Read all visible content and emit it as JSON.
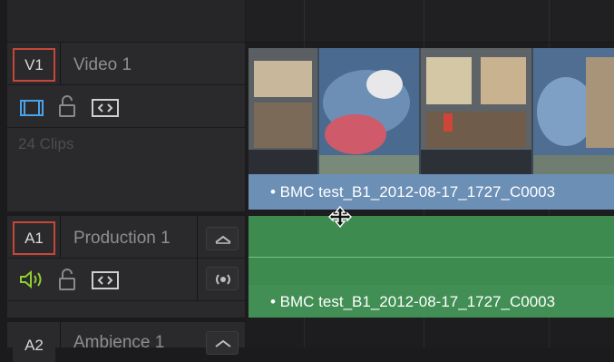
{
  "tracks": [
    {
      "id": "V1",
      "name": "Video 1",
      "clip_count": "24 Clips",
      "clip_label": "• BMC test_B1_2012-08-17_1727_C0003",
      "icons": [
        "clip-view-icon",
        "lock-icon",
        "auto-select-icon"
      ]
    },
    {
      "id": "A1",
      "name": "Production 1",
      "clip_label": "• BMC test_B1_2012-08-17_1727_C0003",
      "icons": [
        "speaker-icon",
        "lock-icon",
        "auto-select-icon",
        "audio-format-icon",
        "disclosure-arrow-icon"
      ]
    },
    {
      "id": "A2",
      "name": "Ambience 1"
    }
  ],
  "colors": {
    "badge_border": "#c7463a",
    "video_clip": "#6c8fb6",
    "audio_clip": "#3d8b4f",
    "speaker": "#8fcf2e",
    "clip_view_icon": "#4aa3e8"
  }
}
